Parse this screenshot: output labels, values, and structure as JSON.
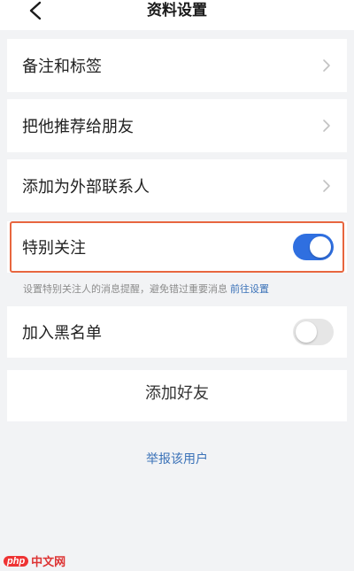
{
  "header": {
    "title": "资料设置",
    "back_icon": "chevron-left-icon"
  },
  "rows": [
    {
      "label": "备注和标签",
      "icon": "chevron-right-icon"
    },
    {
      "label": "把他推荐给朋友",
      "icon": "chevron-right-icon"
    },
    {
      "label": "添加为外部联系人",
      "icon": "chevron-right-icon"
    }
  ],
  "special_follow": {
    "label": "特别关注",
    "enabled": true
  },
  "hint": {
    "text": "设置特别关注人的消息提醒，避免错过重要消息",
    "link": "前往设置"
  },
  "blacklist": {
    "label": "加入黑名单",
    "enabled": false
  },
  "add_friend_label": "添加好友",
  "report_label": "举报该用户",
  "watermark": {
    "badge": "php",
    "text": "中文网"
  },
  "colors": {
    "toggle_on": "#2f6fe0",
    "toggle_off": "#e6e6e6",
    "highlight": "#e8663f",
    "link": "#3b72b8",
    "background": "#f2f3f5"
  }
}
